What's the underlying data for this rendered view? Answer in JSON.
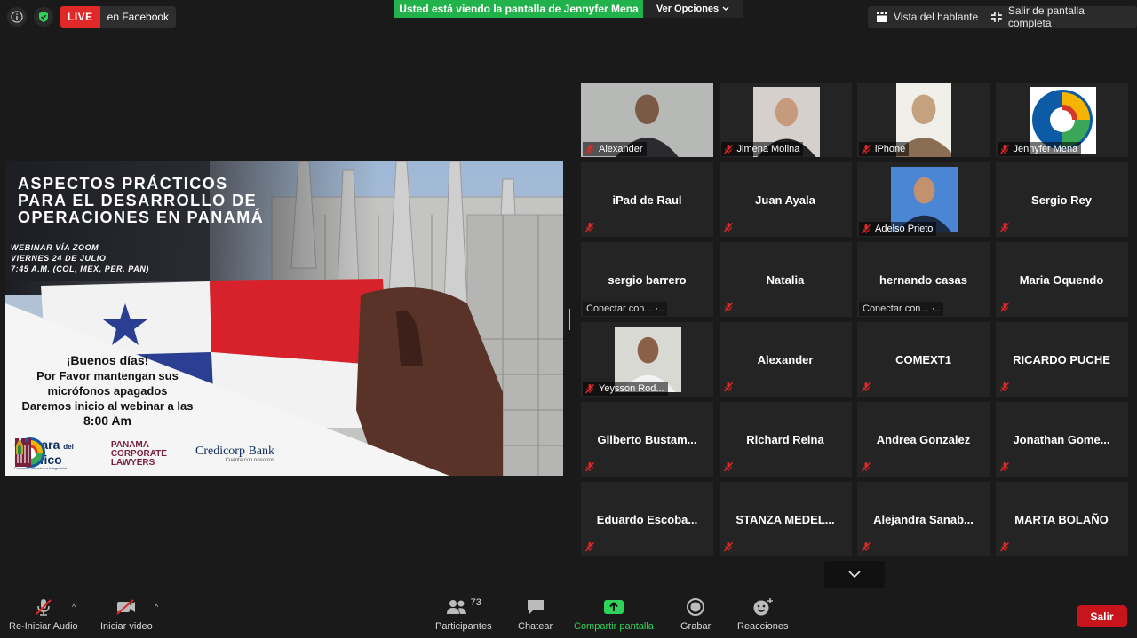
{
  "top": {
    "info_icon": "info-icon",
    "security_icon": "shield-check-icon",
    "live_label": "LIVE",
    "live_platform": "en Facebook",
    "share_banner": "Usted está viendo la pantalla de Jennyfer Mena",
    "view_options": "Ver Opciones",
    "speaker_view": "Vista del hablante",
    "exit_fullscreen": "Salir de pantalla completa"
  },
  "slide": {
    "title_lines": [
      "Aspectos prácticos",
      "para el desarrollo de",
      "operaciones en Panamá"
    ],
    "webinar_lines": [
      "WEBINAR VÍA ZOOM",
      "VIERNES 24 DE JULIO",
      "7:45 A.M. (COL, MEX, PER, PAN)"
    ],
    "greet": "¡Buenos días!",
    "msg1": "Por Favor mantengan sus",
    "msg2": "micrófonos apagados",
    "msg3": "Daremos inicio al webinar a las",
    "time": "8:00 Am",
    "logo1_main": "Cámara",
    "logo1_small": "del",
    "logo1_main2": "Pacífico",
    "logo1_sub": "Comercio, Industria e Integración",
    "logo2_l1": "PANAMA",
    "logo2_l2": "CORPORATE",
    "logo2_l3": "LAWYERS",
    "logo3_name": "Credicorp Bank",
    "logo3_slogan": "Cuenta con nosotros"
  },
  "participants": [
    {
      "name": "Alexander",
      "video": true,
      "muted": true
    },
    {
      "name": "Jimena Molina",
      "video": true,
      "muted": true
    },
    {
      "name": "iPhone",
      "video": true,
      "muted": true
    },
    {
      "name": "Jennyfer Mena",
      "video": true,
      "muted": true
    },
    {
      "name": "iPad de Raul",
      "video": false,
      "muted": true
    },
    {
      "name": "Juan Ayala",
      "video": false,
      "muted": true
    },
    {
      "name": "Adelso Prieto",
      "video": true,
      "muted": true
    },
    {
      "name": "Sergio Rey",
      "video": false,
      "muted": true
    },
    {
      "name": "sergio barrero",
      "video": false,
      "muted": false,
      "status": "Conectar con..."
    },
    {
      "name": "Natalia",
      "video": false,
      "muted": true
    },
    {
      "name": "hernando casas",
      "video": false,
      "muted": false,
      "status": "Conectar con..."
    },
    {
      "name": "Maria Oquendo",
      "video": false,
      "muted": true
    },
    {
      "name": "Yeysson Rod...",
      "video": true,
      "muted": true
    },
    {
      "name": "Alexander",
      "video": false,
      "muted": true
    },
    {
      "name": "COMEXT1",
      "video": false,
      "muted": true
    },
    {
      "name": "RICARDO PUCHE",
      "video": false,
      "muted": true
    },
    {
      "name": "Gilberto  Bustam...",
      "video": false,
      "muted": true
    },
    {
      "name": "Richard Reina",
      "video": false,
      "muted": true
    },
    {
      "name": "Andrea Gonzalez",
      "video": false,
      "muted": true
    },
    {
      "name": "Jonathan  Gome...",
      "video": false,
      "muted": true
    },
    {
      "name": "Eduardo  Escoba...",
      "video": false,
      "muted": true
    },
    {
      "name": "STANZA  MEDEL...",
      "video": false,
      "muted": true
    },
    {
      "name": "Alejandra  Sanab...",
      "video": false,
      "muted": true
    },
    {
      "name": "MARTA BOLAÑO",
      "video": false,
      "muted": true
    }
  ],
  "toolbar": {
    "audio": "Re-Iniciar Audio",
    "video": "Iniciar video",
    "participants": "Participantes",
    "participant_count": "73",
    "chat": "Chatear",
    "share": "Compartir pantalla",
    "record": "Grabar",
    "reactions": "Reacciones",
    "leave": "Salir"
  },
  "colors": {
    "live_red": "#e02828",
    "share_green": "#22b24c",
    "leave_red": "#c8151c",
    "muted_icon": "#e02828"
  }
}
